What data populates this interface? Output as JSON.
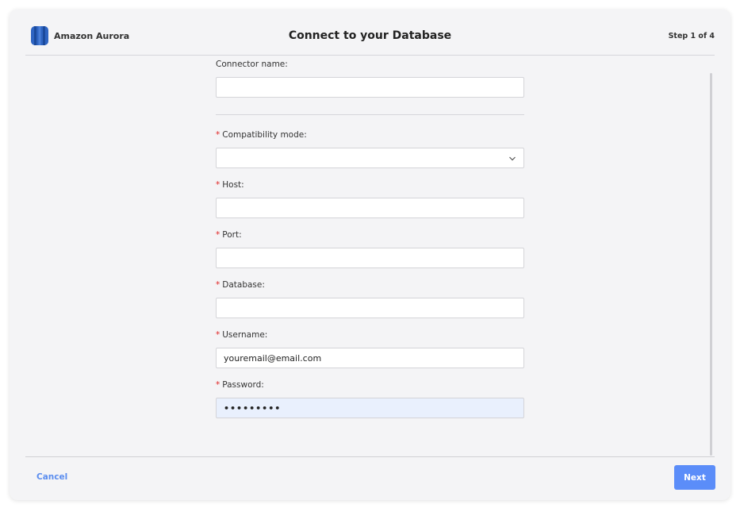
{
  "header": {
    "brand_name": "Amazon Aurora",
    "title": "Connect to your Database",
    "step": "Step 1 of 4"
  },
  "colors": {
    "accent": "#5b8df9",
    "required": "#e02424",
    "logo_blue": "#2e64c2"
  },
  "form": {
    "connector_name": {
      "label": "Connector name:",
      "value": ""
    },
    "compatibility_mode": {
      "label": "Compatibility mode:",
      "value": "",
      "required": true
    },
    "host": {
      "label": "Host:",
      "value": "",
      "required": true
    },
    "port": {
      "label": "Port:",
      "value": "",
      "required": true
    },
    "database": {
      "label": "Database:",
      "value": "",
      "required": true
    },
    "username": {
      "label": "Username:",
      "value": "youremail@email.com",
      "required": true
    },
    "password": {
      "label": "Password:",
      "value": "•••••••••",
      "required": true
    }
  },
  "footer": {
    "cancel_label": "Cancel",
    "next_label": "Next"
  },
  "icons": {
    "logo": "aurora-logo-icon",
    "select_chevron": "chevron-down-icon"
  }
}
